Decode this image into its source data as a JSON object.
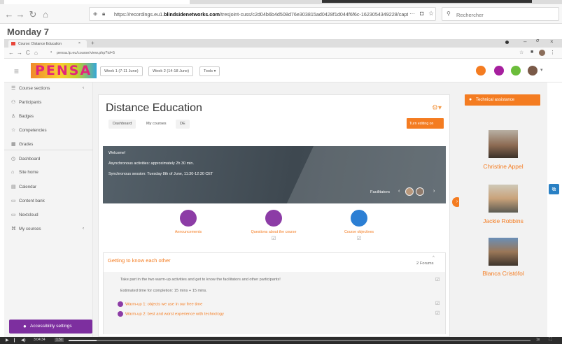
{
  "outer_browser": {
    "url_prefix": "https://recordings.eu1.",
    "url_domain": "blindsidenetworks.com",
    "url_suffix": "/tresjoint-cuss/c2d04b6b4d508d76e303815ad0428f1d044f6f6c-1623054349228/capture/",
    "url_menu": "···",
    "search_placeholder": "Rechercher"
  },
  "recording_title": "Monday 7",
  "inner_browser": {
    "tab_title": "Course: Distance Education",
    "new_tab": "+",
    "url": "pensa.lp.eu/course/view.php?id=5"
  },
  "navbar": {
    "logo": "PENSA",
    "week1": "Week 1 (7-11 June)",
    "week2": "Week 2 (14-18 June)",
    "tools": "Tools ▾"
  },
  "sidebar": {
    "items": [
      {
        "label": "Course sections",
        "icon": "sections-icon"
      },
      {
        "label": "Participants",
        "icon": "participants-icon"
      },
      {
        "label": "Badges",
        "icon": "badge-icon"
      },
      {
        "label": "Competencies",
        "icon": "competencies-icon"
      },
      {
        "label": "Grades",
        "icon": "grades-icon"
      },
      {
        "label": "Dashboard",
        "icon": "dashboard-icon"
      },
      {
        "label": "Site home",
        "icon": "home-icon"
      },
      {
        "label": "Calendar",
        "icon": "calendar-icon"
      },
      {
        "label": "Content bank",
        "icon": "content-bank-icon"
      },
      {
        "label": "Nextcloud",
        "icon": "folder-icon"
      },
      {
        "label": "My courses",
        "icon": "courses-icon"
      }
    ],
    "accessibility": "Accessibility settings"
  },
  "course": {
    "title": "Distance Education",
    "breadcrumbs": [
      "Dashboard",
      "My courses",
      "DE"
    ],
    "turn_editing": "Turn editing on",
    "banner": {
      "welcome": "Welcome!",
      "line1": "Asynchronous activities: approximately 2h 30 min.",
      "line2": "Synchronous session: Tuesday 8th of June, 11:30-12:30 CET",
      "facilitators": "Facilitators"
    },
    "activities": [
      {
        "label": "Announcements",
        "color": "#8c3ca6"
      },
      {
        "label": "Questions about the course",
        "color": "#8c3ca6"
      },
      {
        "label": "Course objectives",
        "color": "#2c7fd4"
      }
    ],
    "section": {
      "title": "Getting to know each other",
      "forums": "2 Forums",
      "desc1": "Take part in the two warm-up activities and get to know the facilitators and other participants!",
      "desc2": "Estimated time for completion: 15 mins + 15 mins.",
      "link1": "Warm-up 1: objects we use in our free time",
      "link2": "Warm-up 2: best and worst experience with technology"
    }
  },
  "right_panel": {
    "tech_assistance": "Technical assistance",
    "facilitators": [
      "Christine Appel",
      "Jackie Robbins",
      "Blanca Cristófol"
    ]
  },
  "player": {
    "time": "3:04:34",
    "speed": "1.5x",
    "playback_rate": "1x"
  },
  "colors": {
    "accent": "#f47c21",
    "purple": "#8c3ca6",
    "accessibility": "#7d2f9f"
  }
}
